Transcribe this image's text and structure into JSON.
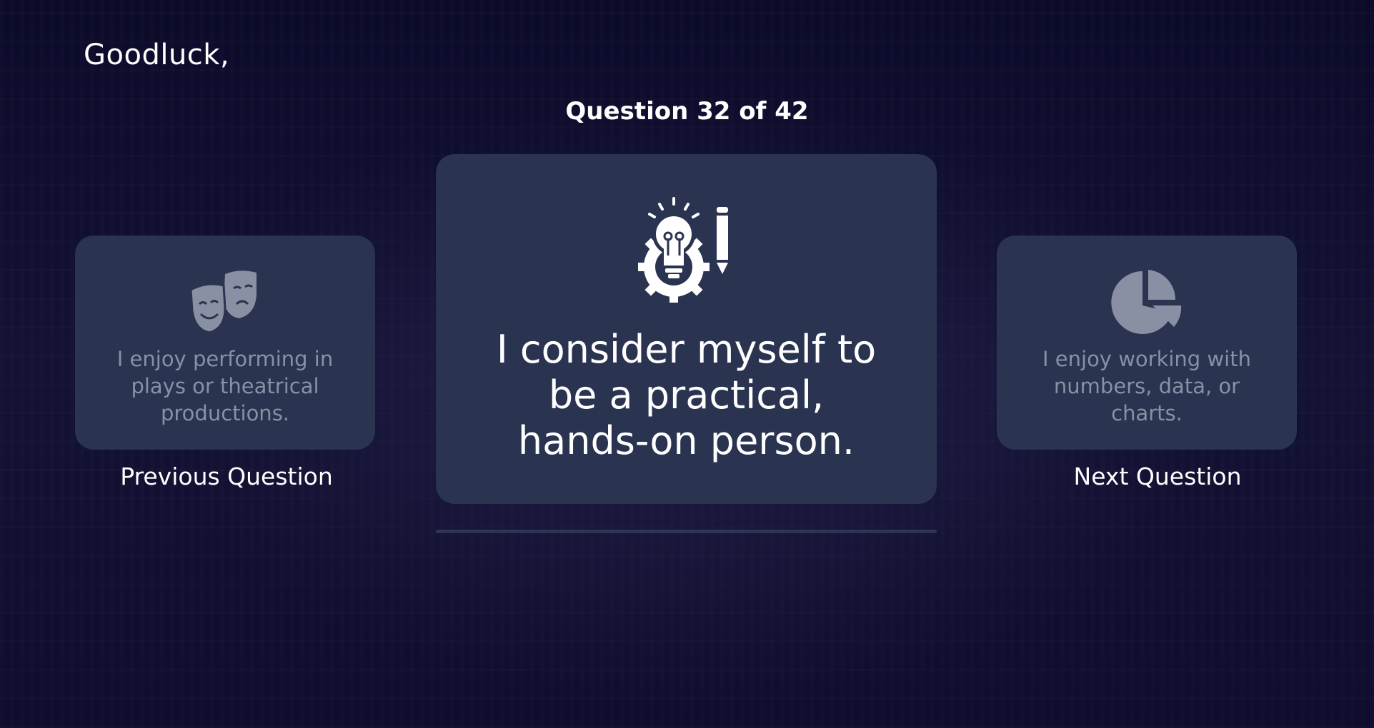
{
  "header": {
    "greeting": "Goodluck,"
  },
  "quiz": {
    "counter": "Question 32 of 42",
    "current": {
      "text": "I consider myself to be a practical, hands-on person.",
      "icon": "lightbulb-gear-pencil-icon"
    },
    "previous": {
      "text": "I enjoy performing in plays or theatrical productions.",
      "icon": "theater-masks-icon",
      "label": "Previous Question"
    },
    "next": {
      "text": "I enjoy working with numbers, data, or charts.",
      "icon": "pie-chart-icon",
      "label": "Next Question"
    }
  },
  "colors": {
    "card": "#2a3350",
    "background": "#0c0b2c",
    "muted_text": "#8a90a4"
  }
}
